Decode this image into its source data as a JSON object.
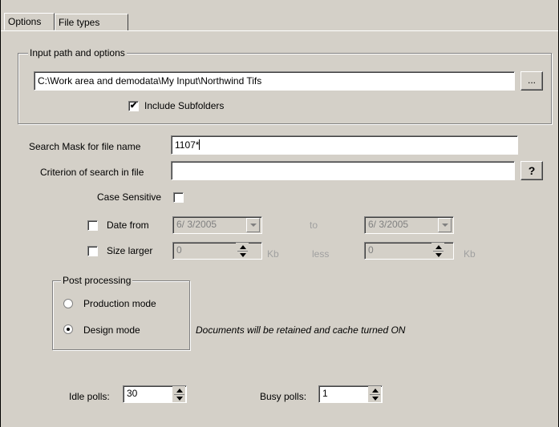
{
  "tabs": [
    {
      "label": "Options",
      "active": true
    },
    {
      "label": "File types",
      "active": false
    }
  ],
  "input_group": {
    "title": "Input path and options",
    "path_value": "C:\\Work area and demodata\\My Input\\Northwind Tifs",
    "browse_label": "...",
    "include_subfolders_label": "Include Subfolders",
    "include_subfolders_checked": true
  },
  "search": {
    "mask_label": "Search Mask for file name",
    "mask_value": "1107*",
    "criterion_label": "Criterion of search in file",
    "criterion_value": "",
    "help_label": "?",
    "case_sensitive_label": "Case Sensitive",
    "case_sensitive_checked": false
  },
  "filters": {
    "date_from_label": "Date from",
    "date_from_value": "6/ 3/2005",
    "date_to_label": "to",
    "date_to_value": "6/ 3/2005",
    "date_checked": false,
    "size_label": "Size larger",
    "size_larger_value": "0",
    "size_unit": "Kb",
    "size_less_label": "less",
    "size_less_value": "0",
    "size_checked": false
  },
  "post_processing": {
    "title": "Post processing",
    "modes": [
      {
        "label": "Production mode",
        "selected": false
      },
      {
        "label": "Design mode",
        "selected": true
      }
    ],
    "note": "Documents will be retained and cache turned ON"
  },
  "polls": {
    "idle_label": "Idle polls:",
    "idle_value": "30",
    "busy_label": "Busy polls:",
    "busy_value": "1"
  },
  "icons": {
    "checked_glyph": "✔",
    "colors": {
      "face": "#d4d0c8",
      "shadow": "#808080",
      "highlight": "#ffffff"
    }
  }
}
